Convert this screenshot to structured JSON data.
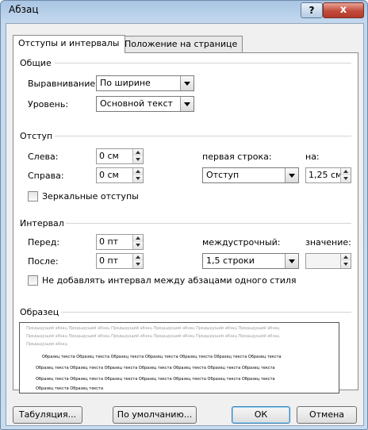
{
  "window": {
    "title": "Абзац",
    "help_label": "?",
    "close_label": "x"
  },
  "tabs": [
    {
      "label": "Отступы и интервалы"
    },
    {
      "label": "Положение на странице"
    }
  ],
  "general": {
    "title": "Общие",
    "alignment_label": "Выравнивание:",
    "alignment_value": "По ширине",
    "level_label": "Уровень:",
    "level_value": "Основной текст"
  },
  "indent": {
    "title": "Отступ",
    "left_label": "Слева:",
    "left_value": "0 см",
    "right_label": "Справа:",
    "right_value": "0 см",
    "first_line_label": "первая строка:",
    "first_line_value": "Отступ",
    "by_label": "на:",
    "by_value": "1,25 см",
    "mirror_label": "Зеркальные отступы",
    "mirror_checked": false
  },
  "spacing": {
    "title": "Интервал",
    "before_label": "Перед:",
    "before_value": "0 пт",
    "after_label": "После:",
    "after_value": "0 пт",
    "line_spacing_label": "междустрочный:",
    "line_spacing_value": "1,5 строки",
    "at_label": "значение:",
    "at_value": "",
    "no_space_label": "Не добавлять интервал между абзацами одного стиля",
    "no_space_checked": false
  },
  "preview": {
    "title": "Образец",
    "prev_lines": [
      "Предыдущий абзац Предыдущий абзац Предыдущий абзац Предыдущий абзац Предыдущий абзац Предыдущий абзац",
      "Предыдущий абзац Предыдущий абзац Предыдущий абзац Предыдущий абзац Предыдущий абзац Предыдущий абзац",
      "Предыдущий абзац"
    ],
    "sample_lines": [
      "Образец текста Образец текста Образец текста Образец текста Образец текста Образец текста Образец текста",
      "Образец текста Образец текста Образец текста Образец текста Образец текста Образец текста Образец текста",
      "Образец текста Образец текста Образец текста Образец текста Образец текста Образец текста Образец текста",
      "Образец текста Образец текста"
    ]
  },
  "buttons": {
    "tabs": "Табуляция...",
    "default": "По умолчанию...",
    "ok": "ОК",
    "cancel": "Отмена"
  }
}
